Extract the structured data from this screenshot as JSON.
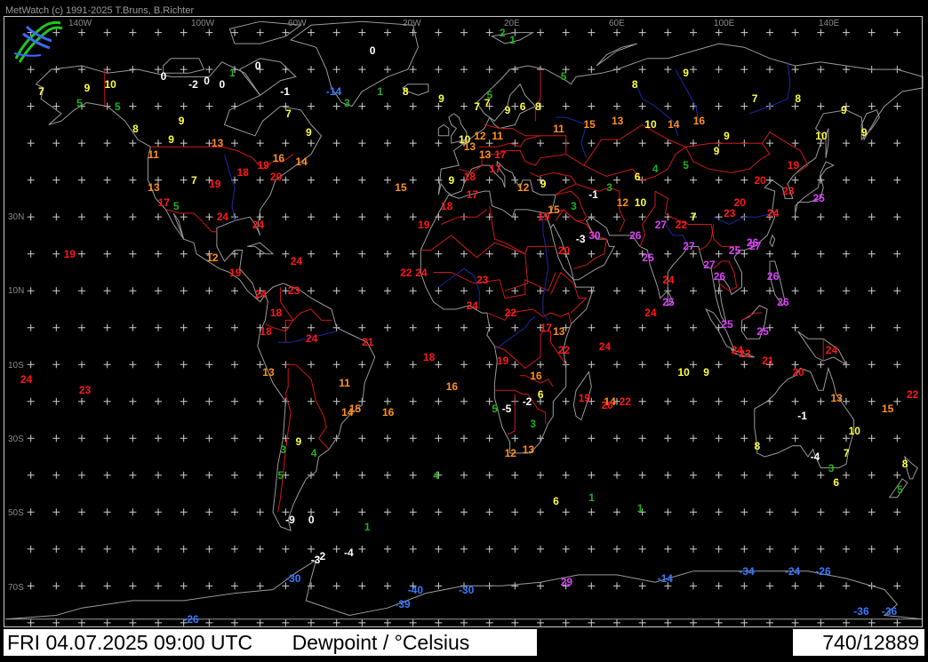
{
  "header": {
    "credit": "MetWatch  (c) 1991-2025 T.Bruns, B.Richter"
  },
  "footer": {
    "datetime": "FRI 04.07.2025 09:00 UTC",
    "title": "Dewpoint / °Celsius",
    "count": "740/12889"
  },
  "axes": {
    "lon_labels": [
      "140W",
      "100W",
      "60W",
      "20W",
      "20E",
      "60E",
      "100E",
      "140E"
    ],
    "lat_labels": [
      "30N",
      "10N",
      "10S",
      "30S",
      "50S",
      "70S"
    ]
  },
  "colors": {
    "background": "#000000",
    "coast": "#9a9a9a",
    "borders": "#d01818",
    "rivers": "#1a2aa0",
    "grid_cross": "#cfcfcf",
    "scale": [
      {
        "max": -10,
        "color": "#3a78ff"
      },
      {
        "max": 0,
        "color": "#ffffff"
      },
      {
        "max": 5,
        "color": "#20b020"
      },
      {
        "max": 10,
        "color": "#ffff40"
      },
      {
        "max": 16,
        "color": "#ff9020"
      },
      {
        "max": 24,
        "color": "#ff1818"
      },
      {
        "max": 99,
        "color": "#e040ff"
      }
    ]
  },
  "observations": [
    {
      "lon": -139,
      "lat": 66,
      "v": 10
    },
    {
      "lon": -117,
      "lat": 68,
      "v": 0
    },
    {
      "lon": -106,
      "lat": 66,
      "v": -2
    },
    {
      "lon": -100,
      "lat": 67,
      "v": 0
    },
    {
      "lon": -94,
      "lat": 66,
      "v": 0
    },
    {
      "lon": -90,
      "lat": 69,
      "v": 1
    },
    {
      "lon": -80,
      "lat": 71,
      "v": 0
    },
    {
      "lon": -70,
      "lat": 64,
      "v": -1
    },
    {
      "lon": -52,
      "lat": 64,
      "v": -14
    },
    {
      "lon": -32,
      "lat": 64,
      "v": 1
    },
    {
      "lon": -35,
      "lat": 75,
      "v": 0
    },
    {
      "lon": 20,
      "lat": 78,
      "v": 1
    },
    {
      "lon": 16,
      "lat": 80,
      "v": 2
    },
    {
      "lon": 11,
      "lat": 63,
      "v": 5
    },
    {
      "lon": 6,
      "lat": 60,
      "v": 7
    },
    {
      "lon": 0,
      "lat": 51,
      "v": 10
    },
    {
      "lon": 2,
      "lat": 49,
      "v": 13
    },
    {
      "lon": 6,
      "lat": 52,
      "v": 12
    },
    {
      "lon": 13,
      "lat": 52,
      "v": 11
    },
    {
      "lon": 8,
      "lat": 47,
      "v": 13
    },
    {
      "lon": 14,
      "lat": 47,
      "v": 17
    },
    {
      "lon": -4,
      "lat": 40,
      "v": 9
    },
    {
      "lon": 2,
      "lat": 41,
      "v": 18
    },
    {
      "lon": 12,
      "lat": 43,
      "v": 17
    },
    {
      "lon": 23,
      "lat": 38,
      "v": 12
    },
    {
      "lon": 32,
      "lat": 39,
      "v": 9
    },
    {
      "lon": 37,
      "lat": 54,
      "v": 11
    },
    {
      "lon": 30,
      "lat": 60,
      "v": 8
    },
    {
      "lon": 49,
      "lat": 55,
      "v": 15
    },
    {
      "lon": 60,
      "lat": 56,
      "v": 13
    },
    {
      "lon": 73,
      "lat": 55,
      "v": 10
    },
    {
      "lon": 82,
      "lat": 55,
      "v": 14
    },
    {
      "lon": 92,
      "lat": 56,
      "v": 16
    },
    {
      "lon": 104,
      "lat": 52,
      "v": 9
    },
    {
      "lon": 116,
      "lat": 40,
      "v": 20
    },
    {
      "lon": 121,
      "lat": 31,
      "v": 24
    },
    {
      "lon": 139,
      "lat": 35,
      "v": 25
    },
    {
      "lon": 127,
      "lat": 37,
      "v": 23
    },
    {
      "lon": 113,
      "lat": 23,
      "v": 26
    },
    {
      "lon": 106,
      "lat": 21,
      "v": 25
    },
    {
      "lon": 100,
      "lat": 14,
      "v": 26
    },
    {
      "lon": 103,
      "lat": 1,
      "v": 25
    },
    {
      "lon": 107,
      "lat": -6,
      "v": 24
    },
    {
      "lon": 121,
      "lat": 14,
      "v": 26
    },
    {
      "lon": 77,
      "lat": 28,
      "v": 27
    },
    {
      "lon": 72,
      "lat": 19,
      "v": 25
    },
    {
      "lon": 80,
      "lat": 13,
      "v": 24
    },
    {
      "lon": 88,
      "lat": 22,
      "v": 27
    },
    {
      "lon": 67,
      "lat": 25,
      "v": 26
    },
    {
      "lon": 51,
      "lat": 25,
      "v": 30
    },
    {
      "lon": 46,
      "lat": 24,
      "v": -3
    },
    {
      "lon": 39,
      "lat": 21,
      "v": 20
    },
    {
      "lon": 31,
      "lat": 30,
      "v": 19
    },
    {
      "lon": 44,
      "lat": 33,
      "v": 3
    },
    {
      "lon": 35,
      "lat": 32,
      "v": 15
    },
    {
      "lon": 3,
      "lat": 36,
      "v": 17
    },
    {
      "lon": -7,
      "lat": 33,
      "v": 18
    },
    {
      "lon": -17,
      "lat": 15,
      "v": 24
    },
    {
      "lon": 3,
      "lat": 6,
      "v": 24
    },
    {
      "lon": 7,
      "lat": 13,
      "v": 23
    },
    {
      "lon": 18,
      "lat": 4,
      "v": 22
    },
    {
      "lon": 32,
      "lat": 0,
      "v": 17
    },
    {
      "lon": 37,
      "lat": -1,
      "v": 13
    },
    {
      "lon": 39,
      "lat": -6,
      "v": 22
    },
    {
      "lon": 28,
      "lat": -13,
      "v": 16
    },
    {
      "lon": 31,
      "lat": -18,
      "v": 6
    },
    {
      "lon": 28,
      "lat": -26,
      "v": 3
    },
    {
      "lon": 18,
      "lat": -34,
      "v": 12
    },
    {
      "lon": 25,
      "lat": -33,
      "v": 13
    },
    {
      "lon": 47,
      "lat": -19,
      "v": 19
    },
    {
      "lon": 57,
      "lat": -20,
      "v": 14
    },
    {
      "lon": 15,
      "lat": -9,
      "v": 19
    },
    {
      "lon": 13,
      "lat": -22,
      "v": 5
    },
    {
      "lon": 17,
      "lat": -22,
      "v": -5
    },
    {
      "lon": 25,
      "lat": -20,
      "v": -2
    },
    {
      "lon": -74,
      "lat": 41,
      "v": 20
    },
    {
      "lon": -87,
      "lat": 42,
      "v": 18
    },
    {
      "lon": -95,
      "lat": 30,
      "v": 24
    },
    {
      "lon": -81,
      "lat": 28,
      "v": 24
    },
    {
      "lon": -98,
      "lat": 39,
      "v": 19
    },
    {
      "lon": -105,
      "lat": 40,
      "v": 7
    },
    {
      "lon": -112,
      "lat": 33,
      "v": 5
    },
    {
      "lon": -118,
      "lat": 34,
      "v": 17
    },
    {
      "lon": -122,
      "lat": 38,
      "v": 13
    },
    {
      "lon": -122,
      "lat": 47,
      "v": 11
    },
    {
      "lon": -114,
      "lat": 51,
      "v": 9
    },
    {
      "lon": -97,
      "lat": 50,
      "v": 13
    },
    {
      "lon": -79,
      "lat": 44,
      "v": 19
    },
    {
      "lon": -73,
      "lat": 46,
      "v": 16
    },
    {
      "lon": -64,
      "lat": 45,
      "v": 14
    },
    {
      "lon": -99,
      "lat": 19,
      "v": 12
    },
    {
      "lon": -90,
      "lat": 15,
      "v": 19
    },
    {
      "lon": -80,
      "lat": 9,
      "v": 24
    },
    {
      "lon": -66,
      "lat": 18,
      "v": 24
    },
    {
      "lon": -74,
      "lat": 4,
      "v": 18
    },
    {
      "lon": -67,
      "lat": 10,
      "v": 23
    },
    {
      "lon": -78,
      "lat": -1,
      "v": 18
    },
    {
      "lon": -77,
      "lat": -12,
      "v": 13
    },
    {
      "lon": -60,
      "lat": -3,
      "v": 24
    },
    {
      "lon": -47,
      "lat": -15,
      "v": 11
    },
    {
      "lon": -43,
      "lat": -22,
      "v": 15
    },
    {
      "lon": -46,
      "lat": -23,
      "v": 14
    },
    {
      "lon": -58,
      "lat": -34,
      "v": 4
    },
    {
      "lon": -70,
      "lat": -33,
      "v": 3
    },
    {
      "lon": -64,
      "lat": -31,
      "v": 9
    },
    {
      "lon": -71,
      "lat": -40,
      "v": 5
    },
    {
      "lon": -68,
      "lat": -52,
      "v": -9
    },
    {
      "lon": -59,
      "lat": -52,
      "v": 0
    },
    {
      "lon": -155,
      "lat": 20,
      "v": 19
    },
    {
      "lon": -149,
      "lat": -17,
      "v": 23
    },
    {
      "lon": -172,
      "lat": -14,
      "v": 24
    },
    {
      "lon": 166,
      "lat": -22,
      "v": 15
    },
    {
      "lon": 178,
      "lat": -18,
      "v": 22
    },
    {
      "lon": 174,
      "lat": -37,
      "v": 8
    },
    {
      "lon": 172,
      "lat": -44,
      "v": 5
    },
    {
      "lon": 151,
      "lat": -34,
      "v": 7
    },
    {
      "lon": 145,
      "lat": -38,
      "v": 3
    },
    {
      "lon": 138,
      "lat": -35,
      "v": -4
    },
    {
      "lon": 116,
      "lat": -32,
      "v": 8
    },
    {
      "lon": 131,
      "lat": -12,
      "v": 20
    },
    {
      "lon": 146,
      "lat": -19,
      "v": 13
    },
    {
      "lon": 133,
      "lat": -24,
      "v": -1
    },
    {
      "lon": 147,
      "lat": -42,
      "v": 6
    },
    {
      "lon": 153,
      "lat": -28,
      "v": 10
    },
    {
      "lon": 144,
      "lat": -6,
      "v": 24
    },
    {
      "lon": 125,
      "lat": 7,
      "v": 26
    },
    {
      "lon": 55,
      "lat": -5,
      "v": 24
    },
    {
      "lon": 73,
      "lat": 4,
      "v": 24
    },
    {
      "lon": 70,
      "lat": -49,
      "v": 1
    },
    {
      "lon": 10,
      "lat": 61,
      "v": 7
    },
    {
      "lon": 24,
      "lat": 60,
      "v": 6
    },
    {
      "lon": 18,
      "lat": 59,
      "v": 9
    },
    {
      "lon": 40,
      "lat": 68,
      "v": 5
    },
    {
      "lon": 68,
      "lat": 66,
      "v": 8
    },
    {
      "lon": 88,
      "lat": 69,
      "v": 9
    },
    {
      "lon": 115,
      "lat": 62,
      "v": 7
    },
    {
      "lon": 132,
      "lat": 62,
      "v": 8
    },
    {
      "lon": 150,
      "lat": 59,
      "v": 9
    },
    {
      "lon": 158,
      "lat": 53,
      "v": 9
    },
    {
      "lon": 140,
      "lat": 52,
      "v": 10
    },
    {
      "lon": 129,
      "lat": 44,
      "v": 19
    },
    {
      "lon": 100,
      "lat": 48,
      "v": 9
    },
    {
      "lon": 88,
      "lat": 44,
      "v": 5
    },
    {
      "lon": 76,
      "lat": 43,
      "v": 4
    },
    {
      "lon": 69,
      "lat": 41,
      "v": 6
    },
    {
      "lon": 58,
      "lat": 38,
      "v": 3
    },
    {
      "lon": 51,
      "lat": 36,
      "v": -1
    },
    {
      "lon": 62,
      "lat": 34,
      "v": 12
    },
    {
      "lon": 69,
      "lat": 34,
      "v": 10
    },
    {
      "lon": 85,
      "lat": 28,
      "v": 22
    },
    {
      "lon": 91,
      "lat": 30,
      "v": 7
    },
    {
      "lon": 104,
      "lat": 31,
      "v": 23
    },
    {
      "lon": 108,
      "lat": 34,
      "v": 20
    },
    {
      "lon": 114,
      "lat": 22,
      "v": 27
    },
    {
      "lon": 96,
      "lat": 17,
      "v": 27
    },
    {
      "lon": 80,
      "lat": 7,
      "v": 25
    },
    {
      "lon": 110,
      "lat": -7,
      "v": 23
    },
    {
      "lon": 117,
      "lat": -1,
      "v": 25
    },
    {
      "lon": 119,
      "lat": -9,
      "v": 21
    },
    {
      "lon": -150,
      "lat": 61,
      "v": 5
    },
    {
      "lon": -147,
      "lat": 65,
      "v": 9
    },
    {
      "lon": -165,
      "lat": 64,
      "v": 7
    },
    {
      "lon": -135,
      "lat": 60,
      "v": 5
    },
    {
      "lon": -128,
      "lat": 54,
      "v": 8
    },
    {
      "lon": -110,
      "lat": 56,
      "v": 9
    },
    {
      "lon": -68,
      "lat": 58,
      "v": 7
    },
    {
      "lon": -60,
      "lat": 53,
      "v": 9
    },
    {
      "lon": -45,
      "lat": 61,
      "v": 3
    },
    {
      "lon": -22,
      "lat": 64,
      "v": 8
    },
    {
      "lon": -8,
      "lat": 62,
      "v": 9
    },
    {
      "lon": -25,
      "lat": 38,
      "v": 15
    },
    {
      "lon": -16,
      "lat": 28,
      "v": 19
    },
    {
      "lon": -23,
      "lat": 15,
      "v": 22
    },
    {
      "lon": -14,
      "lat": -8,
      "v": 18
    },
    {
      "lon": -5,
      "lat": -16,
      "v": 16
    },
    {
      "lon": -30,
      "lat": -23,
      "v": 16
    },
    {
      "lon": -38,
      "lat": -4,
      "v": 21
    },
    {
      "lon": 56,
      "lat": -21,
      "v": 20
    },
    {
      "lon": 63,
      "lat": -20,
      "v": 22
    },
    {
      "lon": 86,
      "lat": -12,
      "v": 10
    },
    {
      "lon": 96,
      "lat": -12,
      "v": 9
    },
    {
      "lon": -10,
      "lat": -40,
      "v": 4
    },
    {
      "lon": 37,
      "lat": -47,
      "v": 6
    },
    {
      "lon": 51,
      "lat": -46,
      "v": 1
    },
    {
      "lon": -37,
      "lat": -54,
      "v": 1
    },
    {
      "lon": -58,
      "lat": -63,
      "v": -3
    },
    {
      "lon": -45,
      "lat": -61,
      "v": -4
    },
    {
      "lon": -56,
      "lat": -62,
      "v": -2
    },
    {
      "lon": 78,
      "lat": -68,
      "v": -14
    },
    {
      "lon": 110,
      "lat": -66,
      "v": -34
    },
    {
      "lon": 140,
      "lat": -66,
      "v": -26
    },
    {
      "lon": 166,
      "lat": -77,
      "v": -36
    },
    {
      "lon": -68,
      "lat": -68,
      "v": -30
    },
    {
      "lon": -25,
      "lat": -75,
      "v": -39
    },
    {
      "lon": -20,
      "lat": -71,
      "v": -40
    },
    {
      "lon": 40,
      "lat": -69,
      "v": 29
    },
    {
      "lon": 0,
      "lat": -71,
      "v": -30
    },
    {
      "lon": -108,
      "lat": -79,
      "v": -26
    },
    {
      "lon": 128,
      "lat": -66,
      "v": -24
    },
    {
      "lon": 155,
      "lat": -77,
      "v": -36
    }
  ]
}
